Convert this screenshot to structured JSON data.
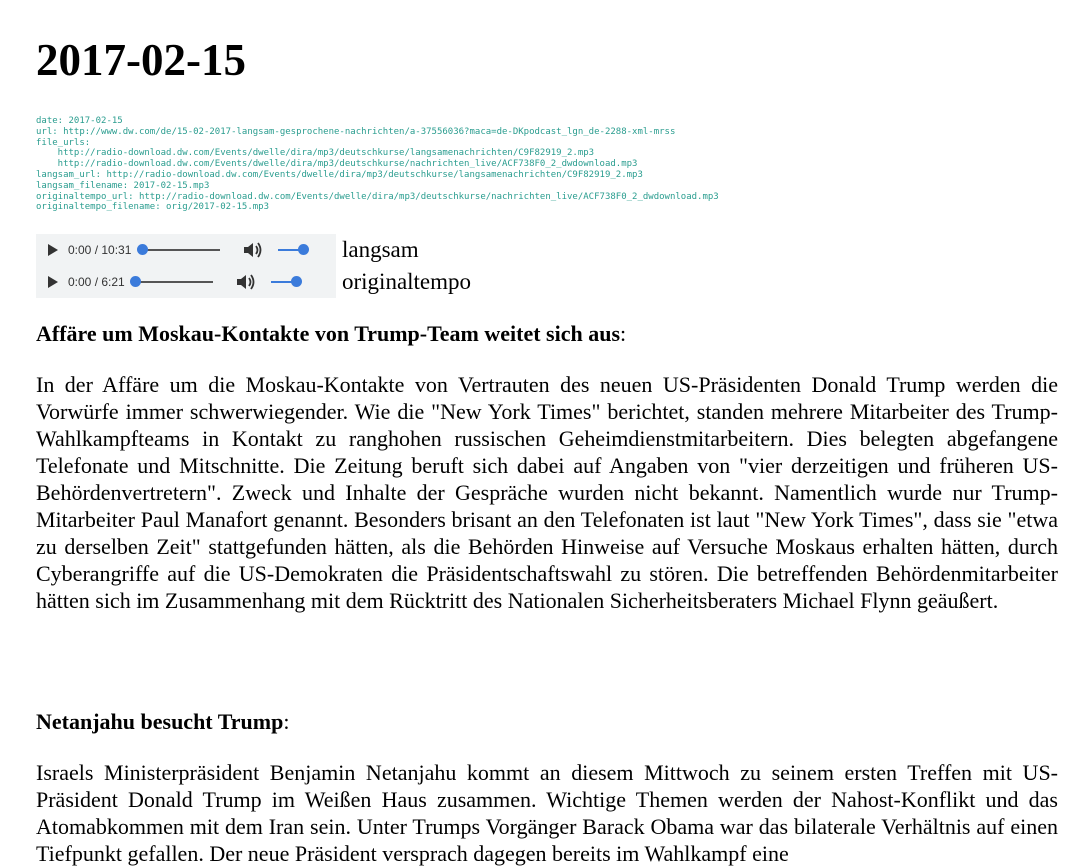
{
  "page_title": "2017-02-15",
  "meta_lines": [
    "date: 2017-02-15",
    "url: http://www.dw.com/de/15-02-2017-langsam-gesprochene-nachrichten/a-37556036?maca=de-DKpodcast_lgn_de-2288-xml-mrss",
    "file_urls:",
    "    http://radio-download.dw.com/Events/dwelle/dira/mp3/deutschkurse/langsamenachrichten/C9F82919_2.mp3",
    "    http://radio-download.dw.com/Events/dwelle/dira/mp3/deutschkurse/nachrichten_live/ACF738F0_2_dwdownload.mp3",
    "langsam_url: http://radio-download.dw.com/Events/dwelle/dira/mp3/deutschkurse/langsamenachrichten/C9F82919_2.mp3",
    "langsam_filename: 2017-02-15.mp3",
    "originaltempo_url: http://radio-download.dw.com/Events/dwelle/dira/mp3/deutschkurse/nachrichten_live/ACF738F0_2_dwdownload.mp3",
    "originaltempo_filename: orig/2017-02-15.mp3"
  ],
  "players": [
    {
      "time": "0:00 / 10:31",
      "label": "langsam",
      "progress": 0.0,
      "volume": 1.0
    },
    {
      "time": "0:00 / 6:21",
      "label": "originaltempo",
      "progress": 0.0,
      "volume": 1.0
    }
  ],
  "articles": [
    {
      "title": "Affäre um Moskau-Kontakte von Trump-Team weitet sich aus",
      "title_suffix": ":",
      "body": "In der Affäre um die Moskau-Kontakte von Vertrauten des neuen US-Präsidenten Donald Trump werden die Vorwürfe immer schwerwiegender. Wie die \"New York Times\" berichtet, standen mehrere Mitarbeiter des Trump-Wahlkampfteams in Kontakt zu ranghohen russischen Geheimdienstmitarbeitern. Dies belegten abgefangene Telefonate und Mitschnitte. Die Zeitung beruft sich dabei auf Angaben von \"vier derzeitigen und früheren US-Behördenvertretern\". Zweck und Inhalte der Gespräche wurden nicht bekannt. Namentlich wurde nur Trump-Mitarbeiter Paul Manafort genannt. Besonders brisant an den Telefonaten ist laut \"New York Times\", dass sie \"etwa zu derselben Zeit\" stattgefunden hätten, als die Behörden Hinweise auf Versuche Moskaus erhalten hätten, durch Cyberangriffe auf die US-Demokraten die Präsidentschaftswahl zu stören. Die betreffenden Behördenmitarbeiter hätten sich im Zusammenhang mit dem Rücktritt des Nationalen Sicherheitsberaters Michael Flynn geäußert."
    },
    {
      "title": "Netanjahu besucht Trump",
      "title_suffix": ":",
      "body": "Israels Ministerpräsident Benjamin Netanjahu kommt an diesem Mittwoch zu seinem ersten Treffen mit US-Präsident Donald Trump im Weißen Haus zusammen. Wichtige Themen werden der Nahost-Konflikt und das Atomabkommen mit dem Iran sein. Unter Trumps Vorgänger Barack Obama war das bilaterale Verhältnis auf einen Tiefpunkt gefallen. Der neue Präsident versprach dagegen bereits im Wahlkampf eine"
    }
  ],
  "colors": {
    "meta_text": "#2a9d8f",
    "player_bg": "#f1f3f4",
    "slider_accent": "#3b7bdb"
  },
  "icons": {
    "play": "play-icon",
    "volume": "volume-icon"
  }
}
